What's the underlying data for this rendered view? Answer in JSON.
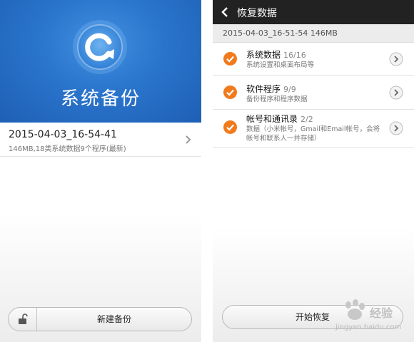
{
  "left": {
    "hero_title": "系统备份",
    "backup": {
      "name": "2015-04-03_16-54-41",
      "detail": "146MB,18类系统数据9个程序(最新)"
    },
    "new_backup_label": "新建备份",
    "colors": {
      "hero": "#2a74cc"
    }
  },
  "right": {
    "title": "恢复数据",
    "subheader": "2015-04-03_16-51-54  146MB",
    "items": [
      {
        "title": "系统数据",
        "count": "16/16",
        "desc": "系统设置和桌面布局等"
      },
      {
        "title": "软件程序",
        "count": "9/9",
        "desc": "备份程序和程序数据"
      },
      {
        "title": "帐号和通讯录",
        "count": "2/2",
        "desc": "数据（小米帐号，Gmail和Email帐号，会将帐号和联系人一并存储）"
      }
    ],
    "start_label": "开始恢复",
    "colors": {
      "topbar": "#222222",
      "check": "#f07a1c"
    }
  },
  "watermark": {
    "brand": "经验",
    "url": "jingyan.baidu.com"
  },
  "icons": [
    "restore-logo-icon",
    "chevron-right-icon",
    "unlock-icon",
    "back-arrow-icon",
    "checkmark-icon",
    "circle-chevron-icon",
    "baidu-paw-icon"
  ]
}
